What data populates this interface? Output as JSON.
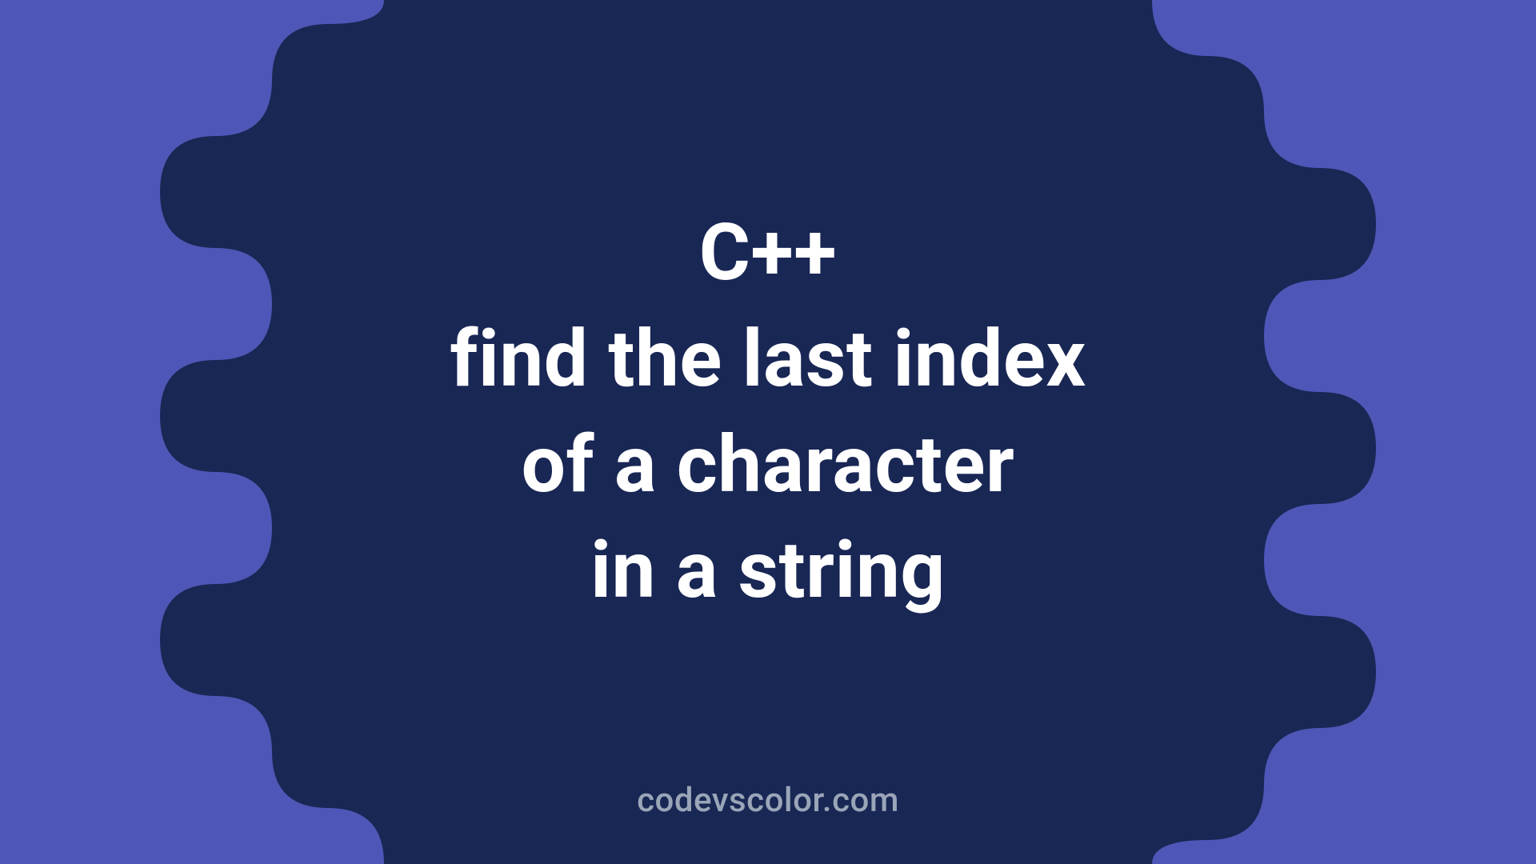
{
  "title": {
    "line1": "C++",
    "line2": "find the last index",
    "line3": "of a character",
    "line4": "in a string"
  },
  "footer": "codevscolor.com",
  "colors": {
    "bg_light": "#4e57b7",
    "bg_dark": "#192755",
    "text": "#ffffff",
    "footer_text": "#9aa5b8"
  }
}
